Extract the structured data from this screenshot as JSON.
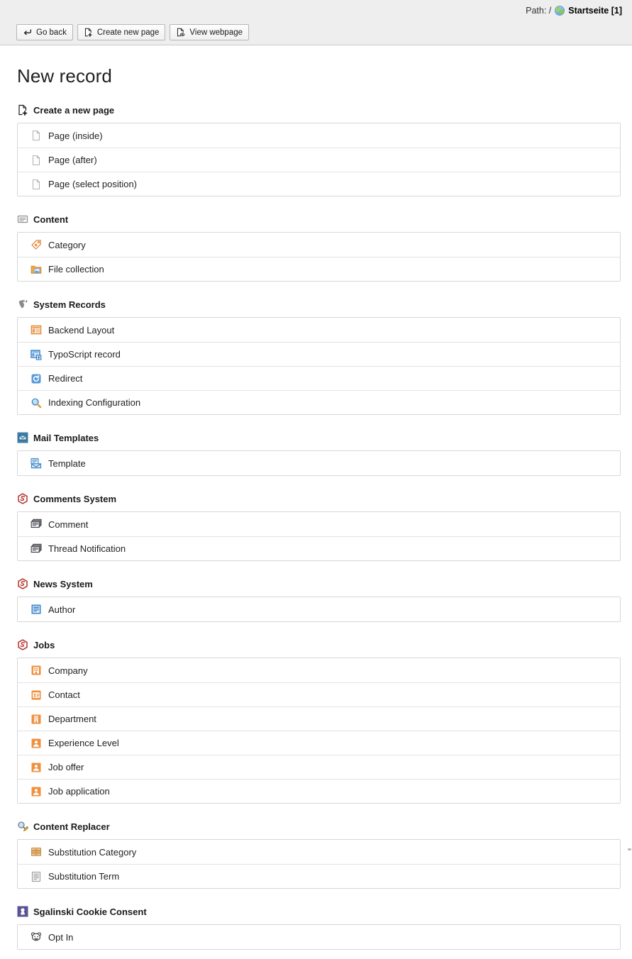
{
  "docheader": {
    "path_label": "Path: /",
    "path_icon": "globe-icon",
    "path_title": "Startseite [1]",
    "buttons": [
      {
        "label": "Go back",
        "icon": "return-arrow-icon"
      },
      {
        "label": "Create new page",
        "icon": "page-new-icon"
      },
      {
        "label": "View webpage",
        "icon": "page-view-icon"
      }
    ]
  },
  "main": {
    "title": "New record",
    "groups": [
      {
        "title": "Create a new page",
        "icon": "page-new-icon",
        "items": [
          {
            "label": "Page (inside)",
            "icon": "page-icon"
          },
          {
            "label": "Page (after)",
            "icon": "page-icon"
          },
          {
            "label": "Page (select position)",
            "icon": "page-icon"
          }
        ]
      },
      {
        "title": "Content",
        "icon": "content-element-icon",
        "items": [
          {
            "label": "Category",
            "icon": "tag-icon"
          },
          {
            "label": "File collection",
            "icon": "folder-image-icon"
          }
        ]
      },
      {
        "title": "System Records",
        "icon": "typo3-logo-icon",
        "items": [
          {
            "label": "Backend Layout",
            "icon": "backend-layout-icon"
          },
          {
            "label": "TypoScript record",
            "icon": "typoscript-icon"
          },
          {
            "label": "Redirect",
            "icon": "redirect-icon"
          },
          {
            "label": "Indexing Configuration",
            "icon": "magnifier-icon"
          }
        ]
      },
      {
        "title": "Mail Templates",
        "icon": "mail-extension-icon",
        "items": [
          {
            "label": "Template",
            "icon": "mail-template-icon"
          }
        ]
      },
      {
        "title": "Comments System",
        "icon": "extension-hexagon-icon",
        "items": [
          {
            "label": "Comment",
            "icon": "comments-icon"
          },
          {
            "label": "Thread Notification",
            "icon": "comments-icon"
          }
        ]
      },
      {
        "title": "News System",
        "icon": "extension-hexagon-icon",
        "items": [
          {
            "label": "Author",
            "icon": "author-card-icon"
          }
        ]
      },
      {
        "title": "Jobs",
        "icon": "extension-hexagon-icon",
        "items": [
          {
            "label": "Company",
            "icon": "company-building-icon"
          },
          {
            "label": "Contact",
            "icon": "contact-card-icon"
          },
          {
            "label": "Department",
            "icon": "department-building-icon"
          },
          {
            "label": "Experience Level",
            "icon": "person-icon"
          },
          {
            "label": "Job offer",
            "icon": "person-icon"
          },
          {
            "label": "Job application",
            "icon": "person-icon"
          }
        ]
      },
      {
        "title": "Content Replacer",
        "icon": "magnifier-pencil-icon",
        "items": [
          {
            "label": "Substitution Category",
            "icon": "drawer-icon"
          },
          {
            "label": "Substitution Term",
            "icon": "document-lines-icon"
          }
        ]
      },
      {
        "title": "Sgalinski Cookie Consent",
        "icon": "cookie-consent-badge-icon",
        "items": [
          {
            "label": "Opt In",
            "icon": "cookie-icon"
          }
        ]
      }
    ]
  },
  "colors": {
    "orange": "#eb8a3d",
    "blue": "#3a87d0",
    "purple": "#5b5397",
    "extension_red": "#b8413a",
    "header_bg": "#eeeeee",
    "border": "#d7d7d7"
  }
}
